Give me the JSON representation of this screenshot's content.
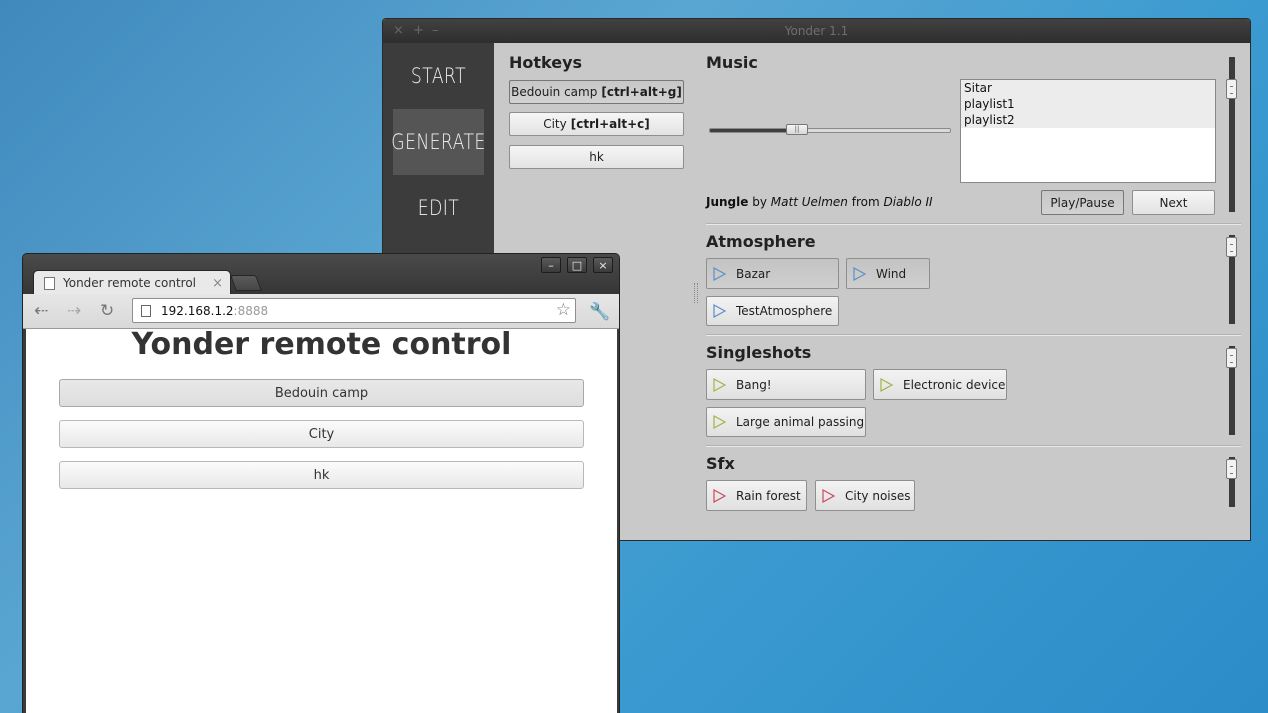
{
  "yonder": {
    "title": "Yonder 1.1",
    "controls": [
      "×",
      "+",
      "–"
    ],
    "nav": [
      {
        "label": "START",
        "active": false
      },
      {
        "label": "GENERATE",
        "active": true
      },
      {
        "label": "EDIT",
        "active": false
      }
    ],
    "hotkeys": {
      "heading": "Hotkeys",
      "buttons": [
        {
          "label": "Bedouin camp",
          "key": "[ctrl+alt+g]",
          "pressed": true
        },
        {
          "label": "City",
          "key": "[ctrl+alt+c]",
          "pressed": false
        },
        {
          "label": "hk",
          "key": "",
          "pressed": false
        }
      ]
    },
    "music": {
      "heading": "Music",
      "playlists": [
        "Sitar",
        "playlist1",
        "playlist2"
      ],
      "volume": 0.37,
      "slider_grip": "||",
      "now_playing": {
        "track": "Jungle",
        "by": "by",
        "artist": "Matt Uelmen",
        "from": "from",
        "album": "Diablo II"
      },
      "play_pause": "Play/Pause",
      "next": "Next"
    },
    "atmosphere": {
      "heading": "Atmosphere",
      "items": [
        "Bazar",
        "Wind",
        "TestAtmosphere"
      ],
      "color": "#5b8fc9"
    },
    "singleshots": {
      "heading": "Singleshots",
      "items": [
        "Bang!",
        "Electronic device",
        "Large animal passing"
      ],
      "color": "#9fb54a"
    },
    "sfx": {
      "heading": "Sfx",
      "items": [
        "Rain forest",
        "City noises"
      ],
      "color": "#c94a5a"
    }
  },
  "browser": {
    "tab_title": "Yonder remote control",
    "tab_close": "×",
    "window_controls": [
      "–",
      "□",
      "×"
    ],
    "url_host": "192.168.1.2",
    "url_port": ":8888",
    "page_title": "Yonder remote control",
    "buttons": [
      "Bedouin camp",
      "City",
      "hk"
    ]
  }
}
